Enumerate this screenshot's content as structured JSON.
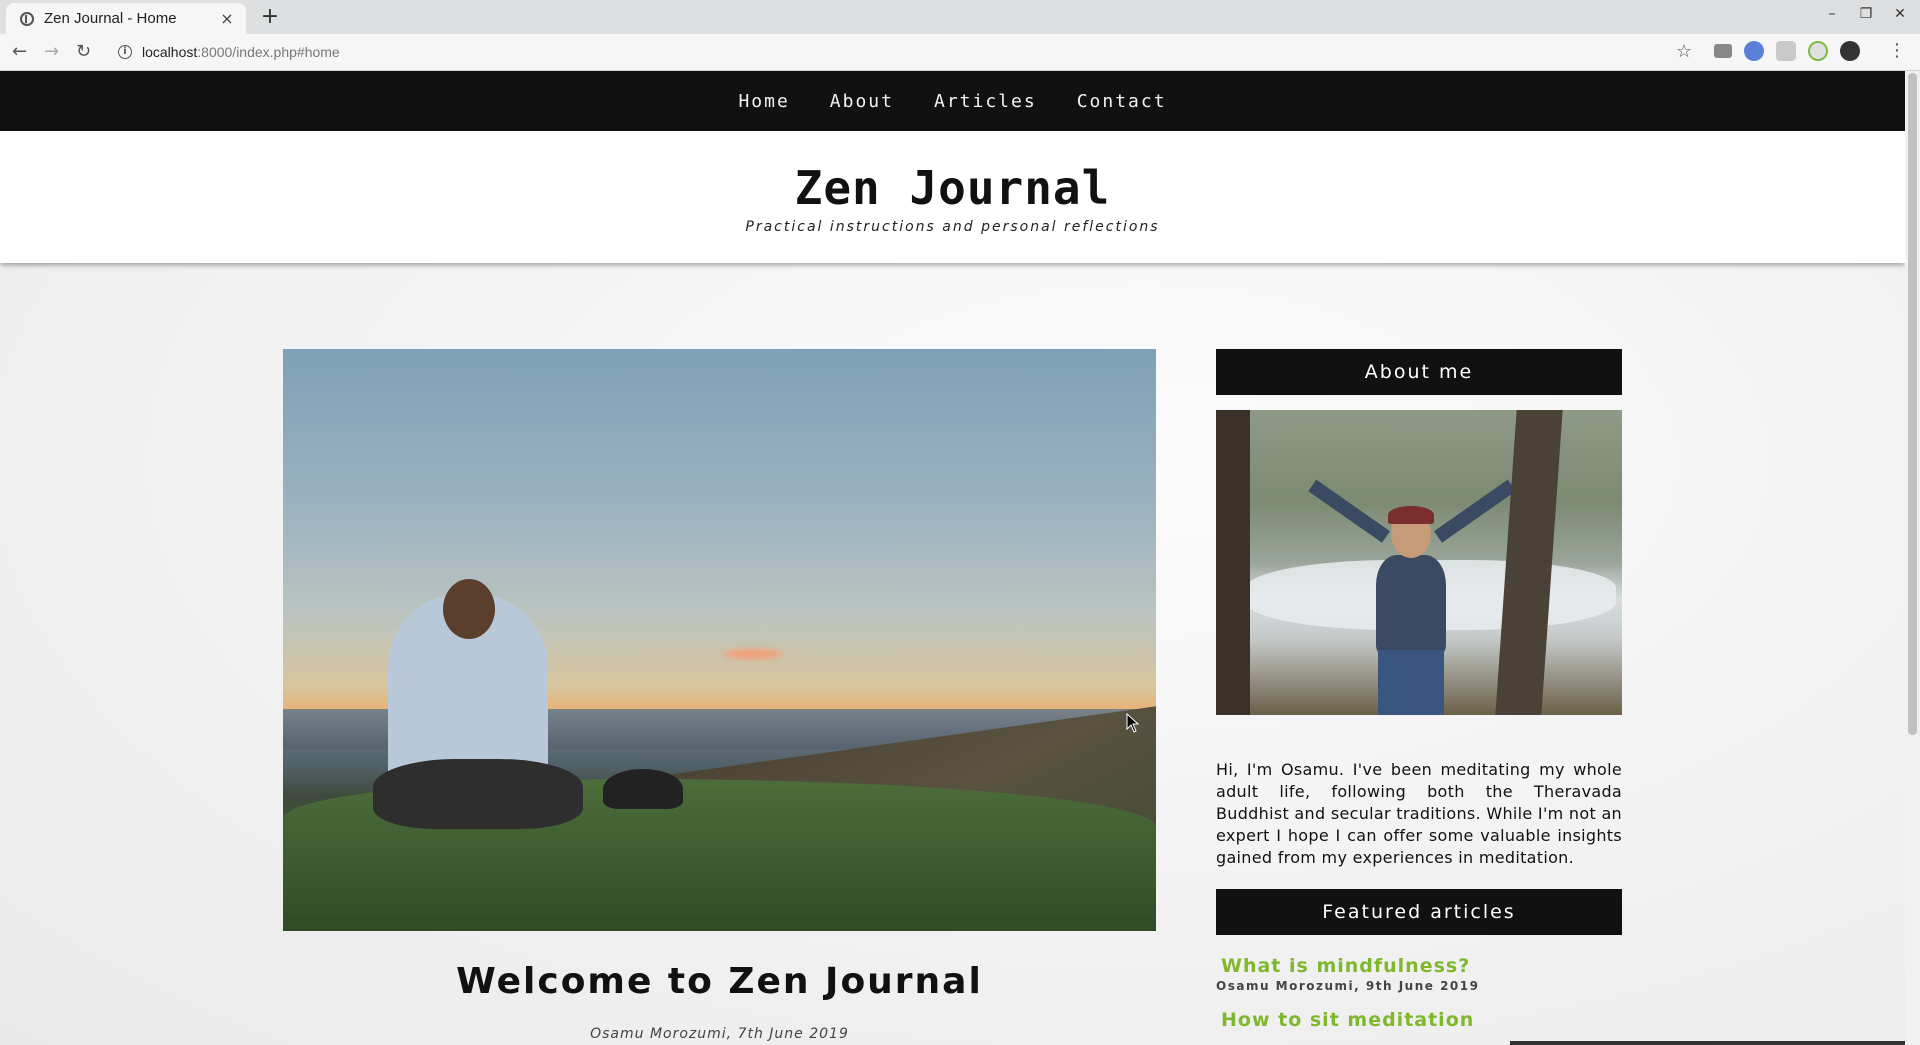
{
  "browser": {
    "tab_title": "Zen Journal - Home",
    "tab_close": "×",
    "new_tab": "+",
    "url_host": "localhost",
    "url_rest": ":8000/index.php#home",
    "window_controls": [
      "–",
      "❐",
      "✕"
    ]
  },
  "site": {
    "nav": [
      "Home",
      "About",
      "Articles",
      "Contact"
    ],
    "title": "Zen Journal",
    "tagline": "Practical instructions and personal reflections"
  },
  "post": {
    "title": "Welcome to Zen Journal",
    "meta": "Osamu Morozumi, 7th June 2019"
  },
  "sidebar": {
    "about_heading": "About me",
    "about_text": "Hi, I'm Osamu. I've been meditating my whole adult life, following both the Theravada Buddhist and secular traditions. While I'm not an expert I hope I can offer some valuable insights gained from my experiences in meditation.",
    "featured_heading": "Featured articles",
    "featured": [
      {
        "title": "What is mindfulness?",
        "meta": "Osamu Morozumi, 9th June 2019"
      },
      {
        "title": "How to sit meditation",
        "meta": ""
      }
    ]
  },
  "colors": {
    "nav_bg": "#111111",
    "accent_green": "#7fb82d"
  }
}
